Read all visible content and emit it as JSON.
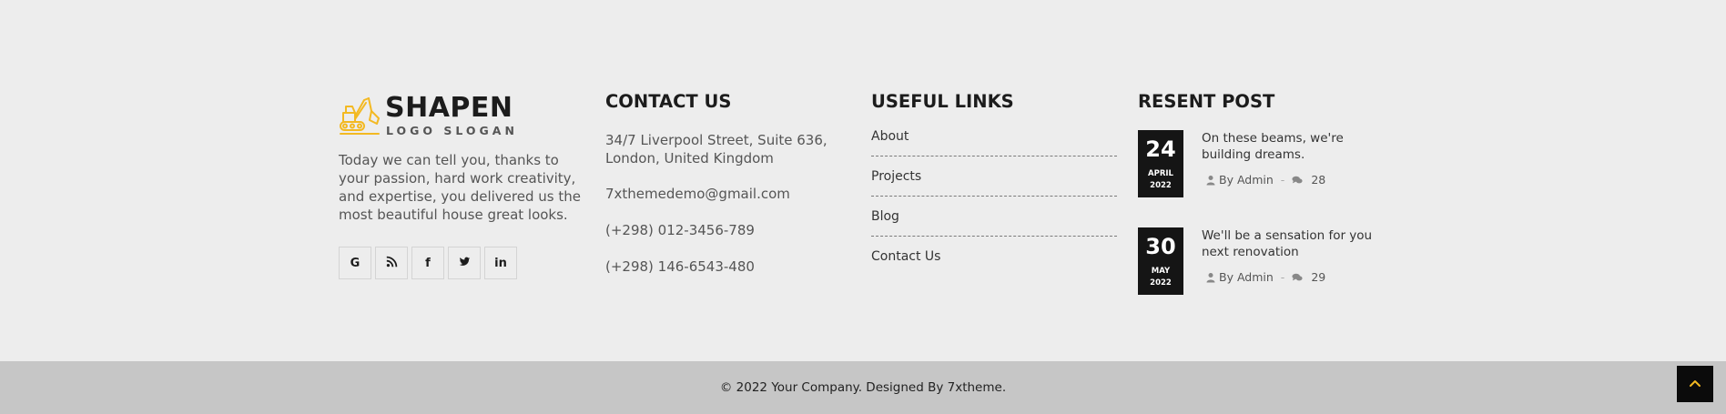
{
  "brand": {
    "name": "SHAPEN",
    "slogan": "LOGO SLOGAN",
    "accent": "#f3b922",
    "icon": "excavator-icon"
  },
  "about": {
    "text": "Today we can tell you, thanks to your passion, hard work creativity, and expertise, you delivered us the most beautiful house great looks."
  },
  "social": [
    {
      "name": "google",
      "icon": "google-icon",
      "glyph": "G"
    },
    {
      "name": "rss",
      "icon": "rss-icon",
      "glyph": ""
    },
    {
      "name": "facebook",
      "icon": "facebook-icon",
      "glyph": "f"
    },
    {
      "name": "twitter",
      "icon": "twitter-icon",
      "glyph": ""
    },
    {
      "name": "linkedin",
      "icon": "linkedin-icon",
      "glyph": "in"
    }
  ],
  "contact": {
    "title": "CONTACT US",
    "address": "34/7 Liverpool Street, Suite 636, London, United Kingdom",
    "email": "7xthemedemo@gmail.com",
    "phone1": "(+298) 012-3456-789",
    "phone2": "(+298) 146-6543-480"
  },
  "links": {
    "title": "USEFUL LINKS",
    "items": [
      "About",
      "Projects",
      "Blog",
      "Contact Us"
    ]
  },
  "posts": {
    "title": "RESENT POST",
    "items": [
      {
        "day": "24",
        "month": "APRIL",
        "year": "2022",
        "title": "On these beams, we're building dreams.",
        "author": "By Admin",
        "comments": "28"
      },
      {
        "day": "30",
        "month": "MAY",
        "year": "2022",
        "title": "We'll be a sensation for you next renovation",
        "author": "By Admin",
        "comments": "29"
      }
    ]
  },
  "copyright": {
    "text": "© 2022 Your Company. Designed By 7xtheme."
  },
  "colors": {
    "background": "#ededed",
    "copyright_bar": "#c6c6c6",
    "date_box": "#151515",
    "accent": "#f3b922"
  }
}
